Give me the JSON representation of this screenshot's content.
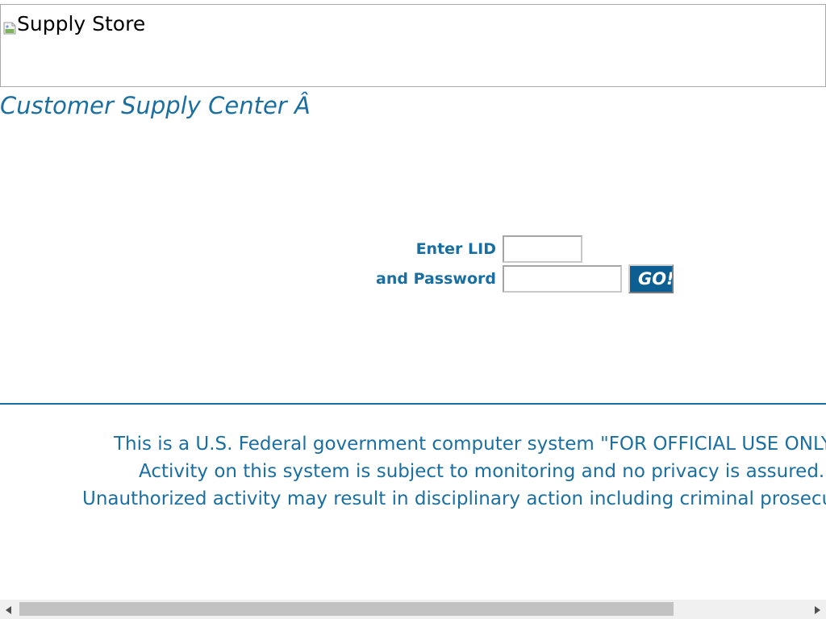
{
  "banner": {
    "image_alt": "Supply Store",
    "icon": "broken-image-icon"
  },
  "page": {
    "title": "Customer Supply Center Â"
  },
  "login": {
    "lid_label": "Enter LID",
    "lid_value": "",
    "password_label": "and Password",
    "password_value": "",
    "go_label": "GO!"
  },
  "notice": {
    "lines": [
      "This is a U.S. Federal government computer system \"FOR OFFICIAL USE ONLY\"",
      "Activity on this system is subject to monitoring and no privacy is assured.",
      "Unauthorized activity may result in disciplinary action including criminal prosecution."
    ]
  },
  "scrollbar": {
    "left_icon": "triangle-left-icon",
    "right_icon": "triangle-right-icon"
  },
  "colors": {
    "brand": "#1a6fa0",
    "button": "#0d5f93"
  }
}
